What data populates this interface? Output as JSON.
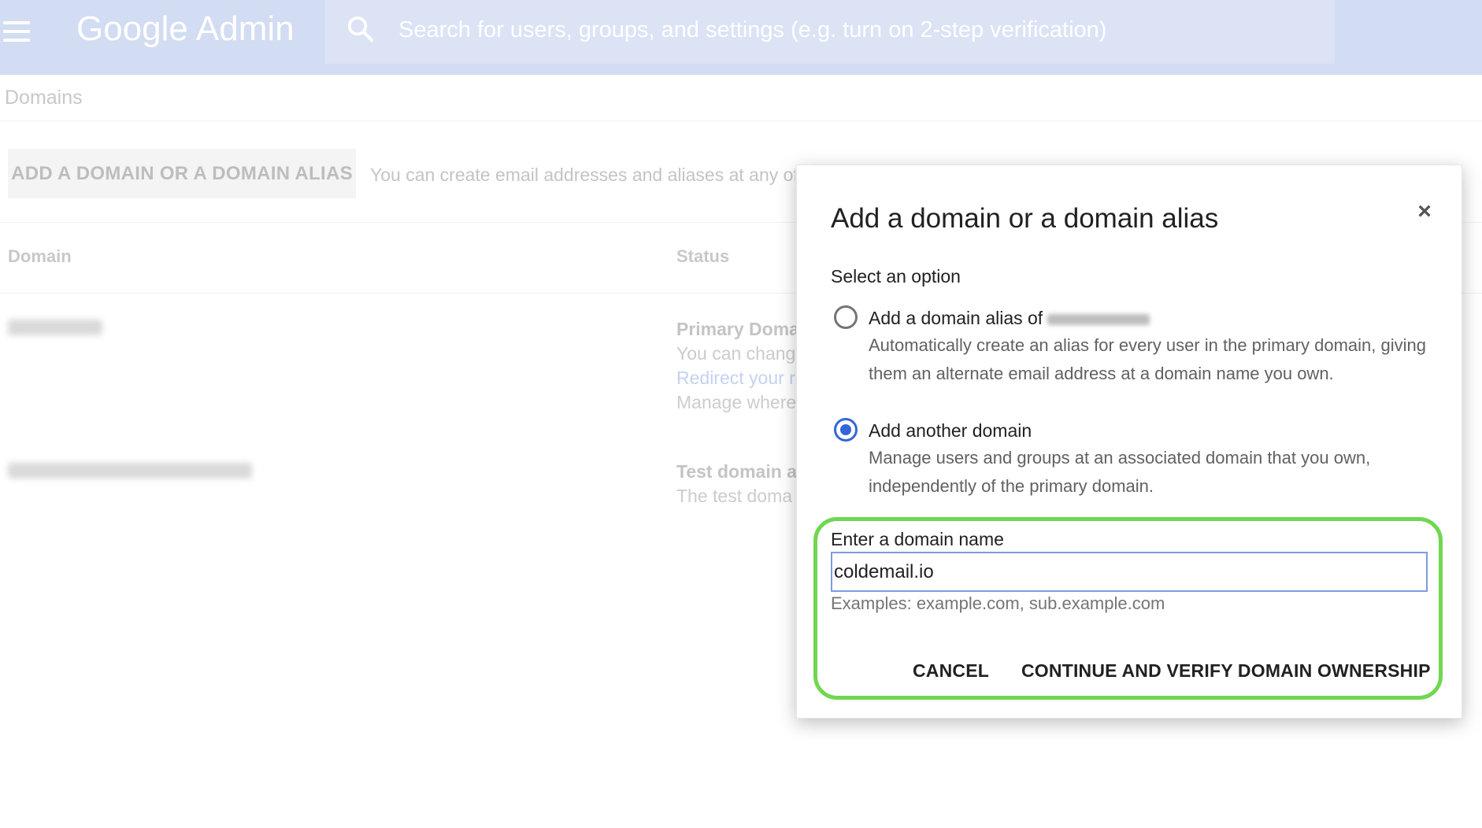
{
  "header": {
    "logo_google": "Google",
    "logo_admin": "Admin",
    "search_placeholder": "Search for users, groups, and settings (e.g. turn on 2-step verification)"
  },
  "page": {
    "breadcrumb": "Domains",
    "add_button_label": "ADD A DOMAIN OR A DOMAIN ALIAS",
    "info_text": "You can create email addresses and aliases at any of",
    "columns": {
      "domain": "Domain",
      "status": "Status"
    },
    "rows": [
      {
        "status_title": "Primary Domai",
        "status_line1": "You can chang",
        "status_link": "Redirect your r",
        "status_line3": "Manage where"
      },
      {
        "status_title": "Test domain al",
        "status_line1": "The test doma"
      }
    ]
  },
  "dialog": {
    "title": "Add a domain or a domain alias",
    "close_symbol": "×",
    "select_label": "Select an option",
    "options": [
      {
        "title": "Add a domain alias of",
        "description": "Automatically create an alias for every user in the primary domain, giving them an alternate email address at a domain name you own.",
        "selected": false
      },
      {
        "title": "Add another domain",
        "description": "Manage users and groups at an associated domain that you own, independently of the primary domain.",
        "selected": true
      }
    ],
    "field_label": "Enter a domain name",
    "field_value": "coldemail.io",
    "examples": "Examples: example.com, sub.example.com",
    "cancel_label": "CANCEL",
    "continue_label": "CONTINUE AND VERIFY DOMAIN OWNERSHIP",
    "highlight_color": "#6fd750",
    "accent_color": "#3367d6"
  }
}
